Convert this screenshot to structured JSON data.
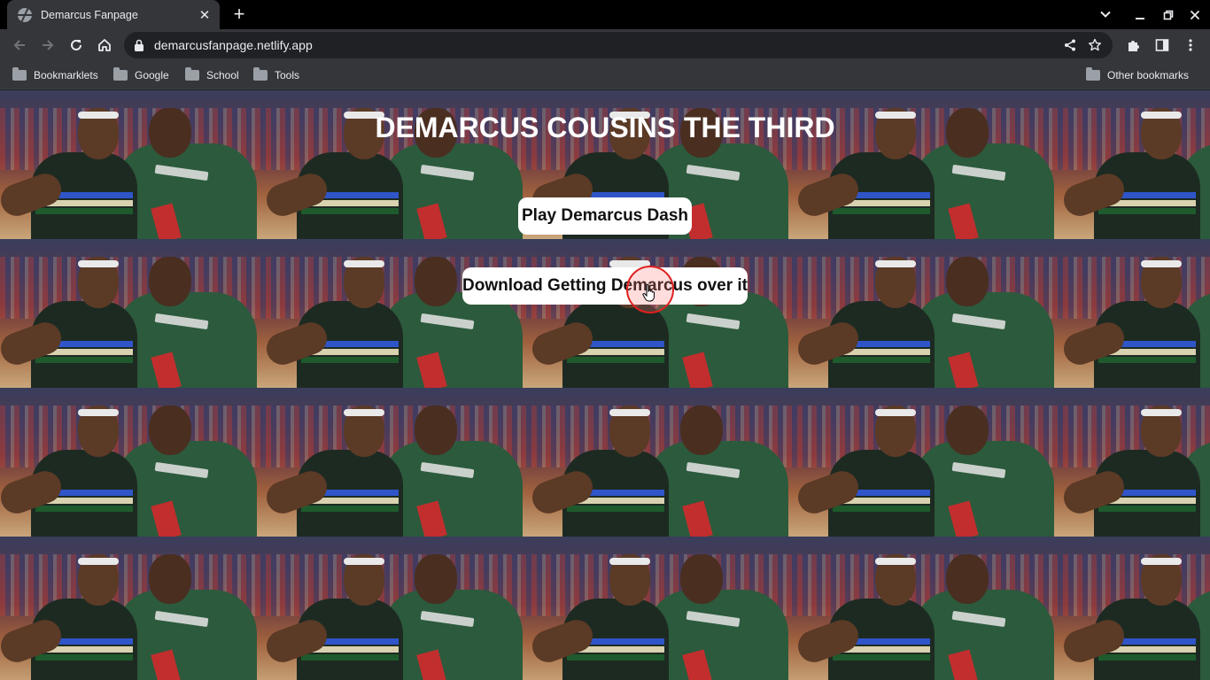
{
  "browser": {
    "tab": {
      "title": "Demarcus Fanpage",
      "close_glyph": "✕"
    },
    "new_tab_glyph": "+",
    "address": {
      "url": "demarcusfanpage.netlify.app"
    },
    "bookmarks": [
      {
        "label": "Bookmarklets"
      },
      {
        "label": "Google"
      },
      {
        "label": "School"
      },
      {
        "label": "Tools"
      }
    ],
    "other_bookmarks": "Other bookmarks"
  },
  "page": {
    "title": "DEMARCUS COUSINS THE THIRD",
    "buttons": {
      "play": "Play Demarcus Dash",
      "download": "Download Getting Demarcus over it"
    }
  },
  "colors": {
    "tab_strip": "#000000",
    "toolbar": "#35363a",
    "omnibox": "#202124",
    "button_bg": "#ffffff",
    "cursor_ring": "#e02020"
  },
  "icons": {
    "favicon": "globe-icon",
    "back": "arrow-left-icon",
    "forward": "arrow-right-icon",
    "reload": "reload-icon",
    "home": "home-icon",
    "lock": "lock-icon",
    "share": "share-icon",
    "star": "star-icon",
    "extensions": "puzzle-icon",
    "side_panel": "side-panel-icon",
    "menu": "kebab-menu-icon"
  }
}
